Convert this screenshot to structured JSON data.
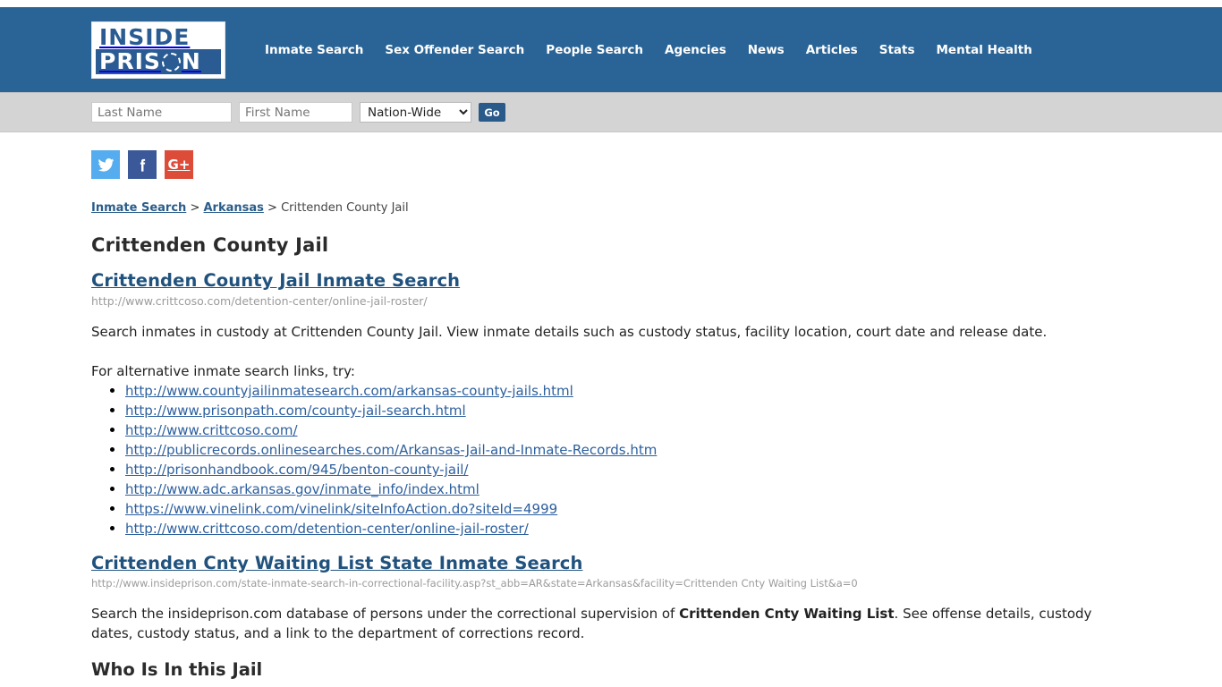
{
  "header": {
    "logo": {
      "top_text": "INSIDE",
      "bottom_prefix": "PRIS",
      "bottom_suffix": "N"
    },
    "nav": [
      {
        "label": "Inmate Search"
      },
      {
        "label": "Sex Offender Search"
      },
      {
        "label": "People Search"
      },
      {
        "label": "Agencies"
      },
      {
        "label": "News"
      },
      {
        "label": "Articles"
      },
      {
        "label": "Stats"
      },
      {
        "label": "Mental Health"
      }
    ],
    "brand_color": "#2a6496"
  },
  "search_bar": {
    "last_name_placeholder": "Last Name",
    "last_name_value": "",
    "first_name_placeholder": "First Name",
    "first_name_value": "",
    "scope_selected": "Nation-Wide",
    "scope_options": [
      "Nation-Wide"
    ],
    "go_label": "Go",
    "go_color": "#2a5a8a"
  },
  "social": [
    {
      "name": "twitter",
      "label": "Twitter",
      "color": "#55acee"
    },
    {
      "name": "facebook",
      "label": "Facebook",
      "color": "#3b5998"
    },
    {
      "name": "googleplus",
      "label": "Google Plus",
      "glyph": "G+",
      "color": "#dd4b39"
    }
  ],
  "breadcrumb": {
    "item1": "Inmate Search",
    "sep1": ">",
    "item2": "Arkansas",
    "sep2": ">",
    "current": "Crittenden County Jail"
  },
  "page_title": "Crittenden County Jail",
  "sections": [
    {
      "heading": "Crittenden County Jail Inmate Search",
      "url": "http://www.crittcoso.com/detention-center/online-jail-roster/",
      "paragraph": "Search inmates in custody at Crittenden County Jail. View inmate details such as custody status, facility location, court date and release date.",
      "alt_intro": "For alternative inmate search links, try:",
      "links": [
        "http://www.countyjailinmatesearch.com/arkansas-county-jails.html",
        "http://www.prisonpath.com/county-jail-search.html",
        "http://www.crittcoso.com/",
        "http://publicrecords.onlinesearches.com/Arkansas-Jail-and-Inmate-Records.htm",
        "http://prisonhandbook.com/945/benton-county-jail/",
        "http://www.adc.arkansas.gov/inmate_info/index.html",
        "https://www.vinelink.com/vinelink/siteInfoAction.do?siteId=4999",
        "http://www.crittcoso.com/detention-center/online-jail-roster/"
      ]
    },
    {
      "heading": "Crittenden Cnty Waiting List State Inmate Search",
      "url": "http://www.insideprison.com/state-inmate-search-in-correctional-facility.asp?st_abb=AR&state=Arkansas&facility=Crittenden Cnty Waiting List&a=0",
      "paragraph_part1": "Search the insideprison.com database of persons under the correctional supervision of ",
      "paragraph_bold": "Crittenden Cnty Waiting List",
      "paragraph_part2": ". See offense details, custody dates, custody status, and a link to the department of corrections record."
    }
  ],
  "next_heading": "Who Is In this Jail"
}
